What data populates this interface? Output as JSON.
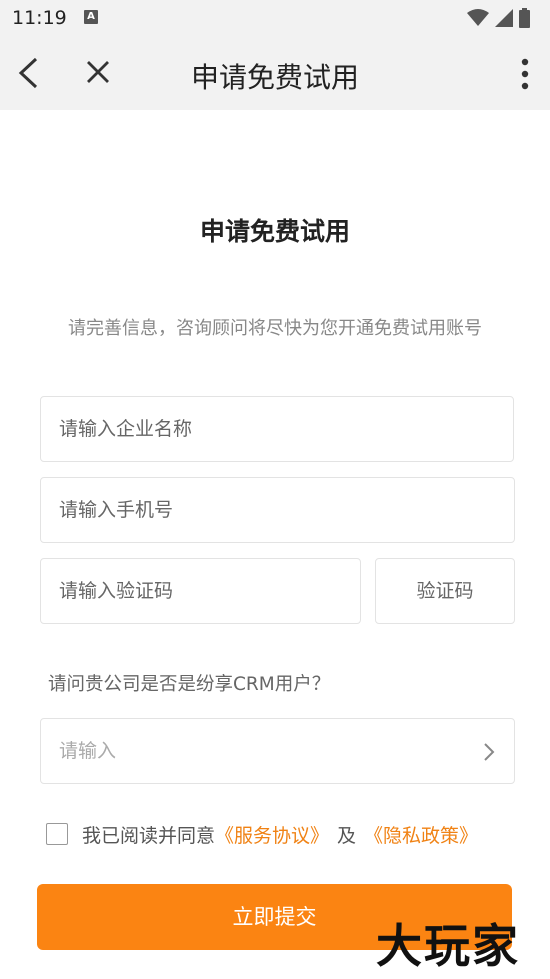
{
  "status_bar": {
    "time": "11:19",
    "notification_icon_letter": "A"
  },
  "nav": {
    "title": "申请免费试用"
  },
  "form": {
    "heading": "申请免费试用",
    "subtitle": "请完善信息，咨询顾问将尽快为您开通免费试用账号",
    "company_placeholder": "请输入企业名称",
    "phone_placeholder": "请输入手机号",
    "code_placeholder": "请输入验证码",
    "code_button_label": "验证码",
    "question": "请问贵公司是否是纷享CRM用户？",
    "select_placeholder": "请输入",
    "agree_text": "我已阅读并同意",
    "service_link": "《服务协议》",
    "and_text": "及",
    "privacy_link": "《隐私政策》",
    "submit_label": "立即提交"
  },
  "watermark": "大玩家",
  "colors": {
    "accent": "#fb8412",
    "link": "#f08214",
    "bar_bg": "#f2f2f2"
  }
}
